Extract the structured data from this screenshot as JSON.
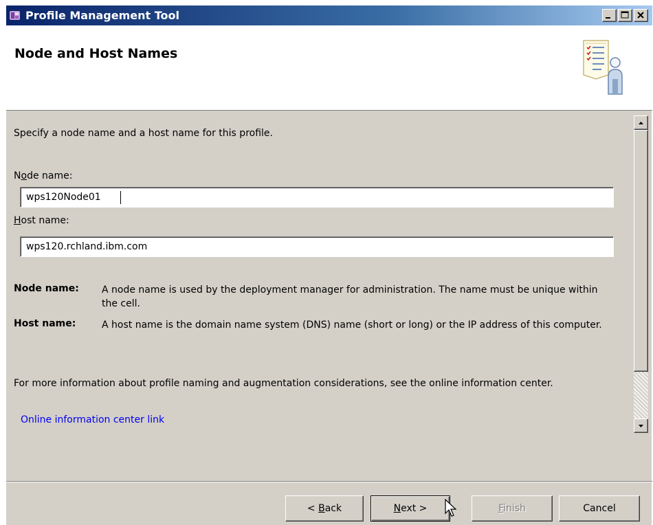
{
  "window": {
    "title": "Profile Management Tool",
    "title_bar_colors": {
      "start": "#0a246a",
      "end": "#a6caf0"
    }
  },
  "header": {
    "title": "Node and Host Names",
    "icon": "profile-checklist-person-icon"
  },
  "content": {
    "intro": "Specify a node name and a host name for this profile.",
    "node_label": {
      "prefix": "N",
      "mnemonic": "o",
      "suffix": "de name:"
    },
    "node_value": "wps120Node01",
    "host_label": {
      "mnemonic": "H",
      "suffix": "ost name:"
    },
    "host_value": "wps120.rchland.ibm.com",
    "descriptions": [
      {
        "label": "Node name:",
        "text": "A node name is used by the deployment manager for administration. The name must be unique within the cell."
      },
      {
        "label": "Host name:",
        "text": "A host name is the domain name system (DNS) name (short or long) or the IP address of this computer."
      }
    ],
    "more_info": "For more information about profile naming and augmentation considerations, see the online information center.",
    "link_text": "Online information center link",
    "link_color": "#0000ee"
  },
  "buttons": {
    "back": {
      "prefix": "< ",
      "mnemonic": "B",
      "suffix": "ack"
    },
    "next": {
      "mnemonic": "N",
      "suffix": "ext >"
    },
    "finish": {
      "mnemonic": "F",
      "suffix": "inish"
    },
    "cancel": "Cancel"
  }
}
